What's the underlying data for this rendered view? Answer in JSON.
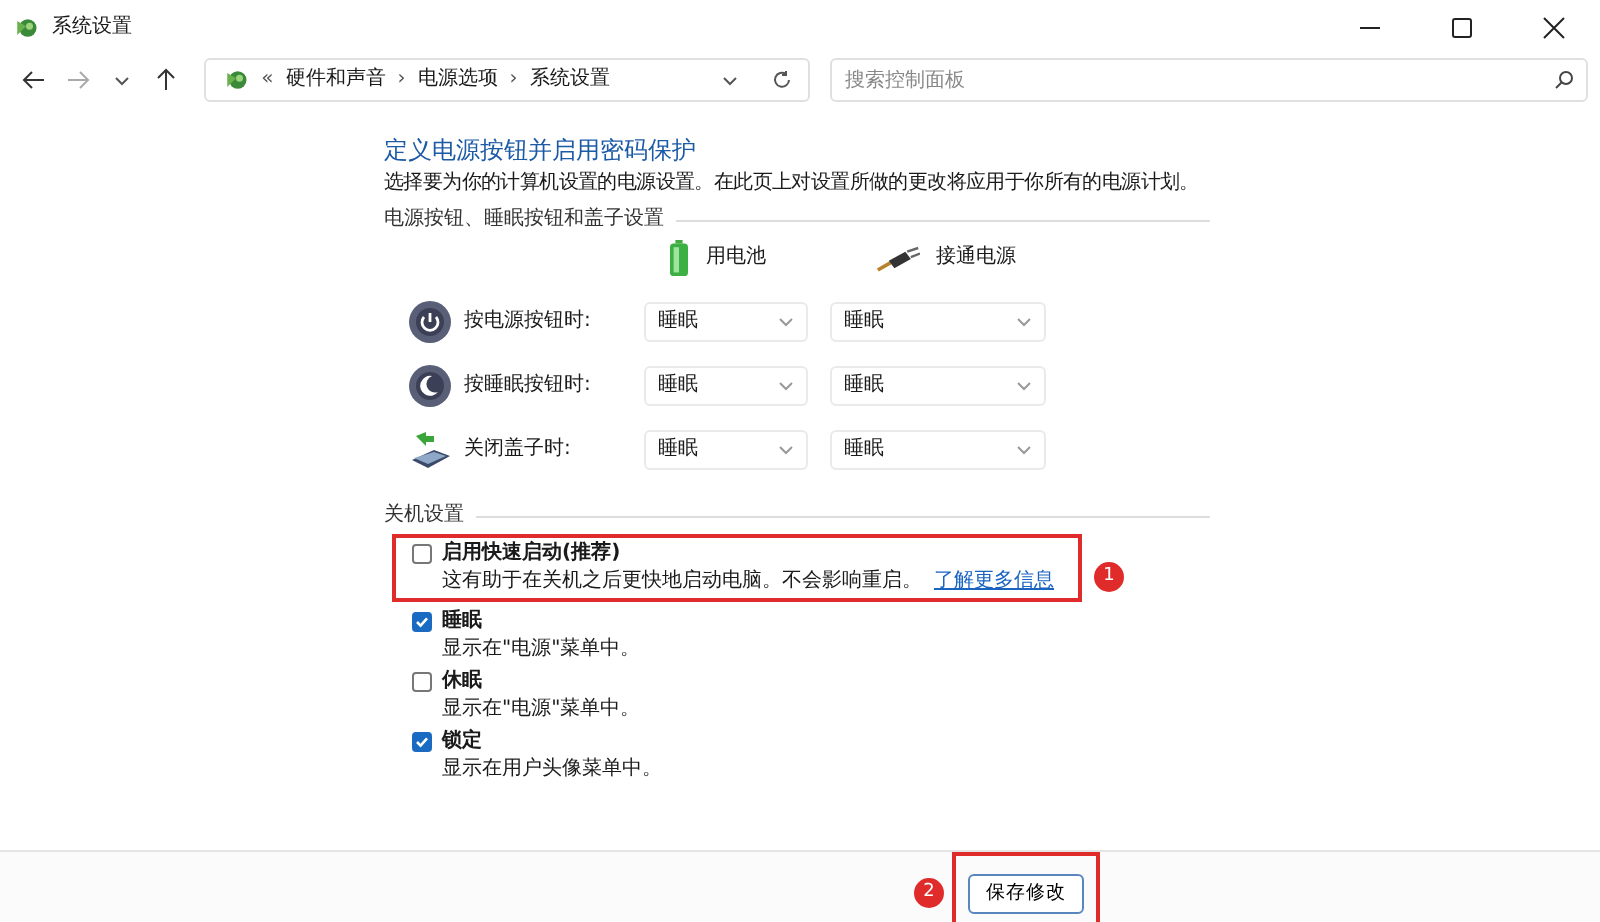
{
  "window": {
    "title": "系统设置"
  },
  "address_bar": {
    "breadcrumbs": [
      "硬件和声音",
      "电源选项",
      "系统设置"
    ],
    "separator": "›",
    "overflow": "«"
  },
  "search": {
    "placeholder": "搜索控制面板"
  },
  "heading": "定义电源按钮并启用密码保护",
  "description": "选择要为你的计算机设置的电源设置。在此页上对设置所做的更改将应用于你所有的电源计划。",
  "power_section": {
    "title": "电源按钮、睡眠按钮和盖子设置",
    "columns": [
      {
        "kind": "battery",
        "label": "用电池"
      },
      {
        "kind": "plug",
        "label": "接通电源"
      }
    ],
    "rows": [
      {
        "kind": "power",
        "label": "按电源按钮时:",
        "values": [
          "睡眠",
          "睡眠"
        ]
      },
      {
        "kind": "sleep",
        "label": "按睡眠按钮时:",
        "values": [
          "睡眠",
          "睡眠"
        ]
      },
      {
        "kind": "lid",
        "label": "关闭盖子时:",
        "values": [
          "睡眠",
          "睡眠"
        ]
      }
    ]
  },
  "shutdown_section": {
    "title": "关机设置",
    "items": [
      {
        "label": "启用快速启动(推荐)",
        "checked": false,
        "description": "这有助于在关机之后更快地启动电脑。不会影响重启。",
        "link": "了解更多信息",
        "highlighted": true,
        "badge": "1"
      },
      {
        "label": "睡眠",
        "checked": true,
        "description": "显示在\"电源\"菜单中。",
        "highlighted": false
      },
      {
        "label": "休眠",
        "checked": false,
        "description": "显示在\"电源\"菜单中。",
        "highlighted": false
      },
      {
        "label": "锁定",
        "checked": true,
        "description": "显示在用户头像菜单中。",
        "highlighted": false
      }
    ]
  },
  "footer": {
    "save_button": "保存修改",
    "highlighted": true,
    "badge": "2"
  }
}
